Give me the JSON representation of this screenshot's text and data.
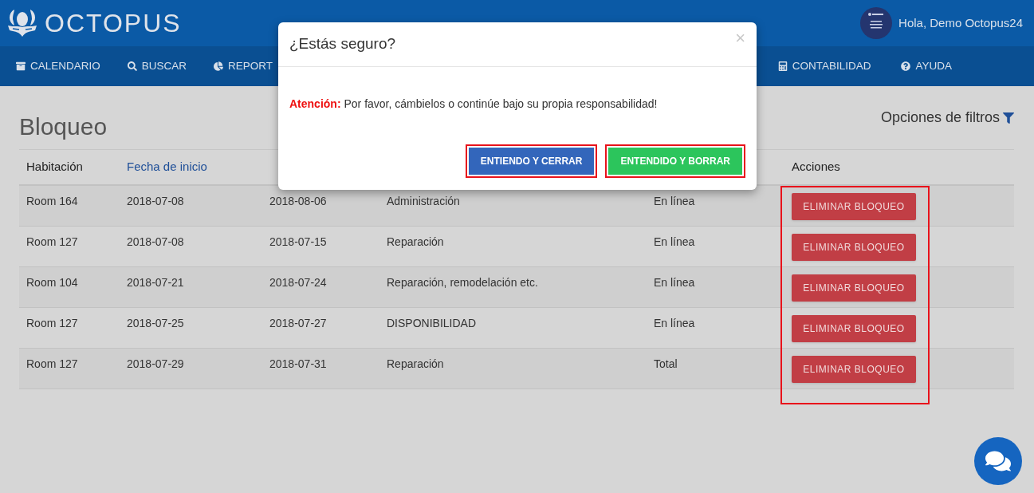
{
  "header": {
    "brand": "OCTOPUS",
    "greeting": "Hola, Demo Octopus24"
  },
  "nav": {
    "left": [
      {
        "label": "CALENDARIO",
        "kind": "calendar"
      },
      {
        "label": "BUSCAR",
        "kind": "search"
      },
      {
        "label": "REPORT",
        "kind": "report"
      }
    ],
    "right": [
      {
        "label": "CONTABILIDAD",
        "kind": "accounting"
      },
      {
        "label": "AYUDA",
        "kind": "help"
      }
    ]
  },
  "page": {
    "title": "Bloqueo",
    "filter_label": "Opciones de filtros"
  },
  "table": {
    "columns": [
      {
        "label": "Habitación",
        "sortable": false
      },
      {
        "label": "Fecha de inicio",
        "sortable": true
      },
      {
        "label": "Acciones",
        "sortable": false
      }
    ],
    "actions_highlighted": true,
    "rows": [
      {
        "room": "Room 164",
        "start": "2018-07-08",
        "end": "2018-08-06",
        "reason": "Administración",
        "type": "En línea",
        "action": "ELIMINAR BLOQUEO"
      },
      {
        "room": "Room 127",
        "start": "2018-07-08",
        "end": "2018-07-15",
        "reason": "Reparación",
        "type": "En línea",
        "action": "ELIMINAR BLOQUEO"
      },
      {
        "room": "Room 104",
        "start": "2018-07-21",
        "end": "2018-07-24",
        "reason": "Reparación, remodelación etc.",
        "type": "En línea",
        "action": "ELIMINAR BLOQUEO"
      },
      {
        "room": "Room 127",
        "start": "2018-07-25",
        "end": "2018-07-27",
        "reason": "DISPONIBILIDAD",
        "type": "En línea",
        "action": "ELIMINAR BLOQUEO"
      },
      {
        "room": "Room 127",
        "start": "2018-07-29",
        "end": "2018-07-31",
        "reason": "Reparación",
        "type": "Total",
        "action": "ELIMINAR BLOQUEO"
      }
    ]
  },
  "dialog": {
    "title": "¿Estás seguro?",
    "close": "×",
    "message": "**Atención:** Por favor, cámbielos o continúe bajo su propia responsabilidad!",
    "buttons": [
      {
        "label": "ENTIENDO Y CERRAR",
        "kind": "primary",
        "highlighted": true
      },
      {
        "label": "ENTENDIDO Y BORRAR",
        "kind": "success",
        "highlighted": true
      }
    ]
  }
}
